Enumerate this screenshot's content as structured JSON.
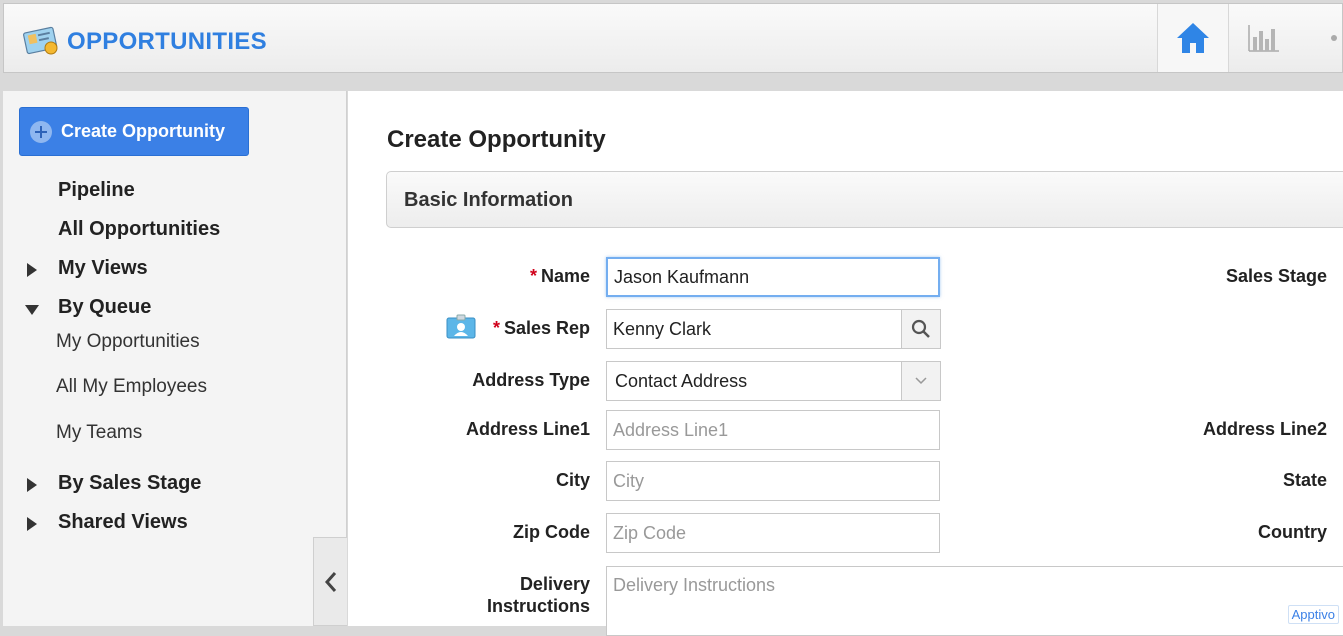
{
  "header": {
    "title": "OPPORTUNITIES",
    "icons": {
      "app": "opportunities-card-icon",
      "home": "home-icon",
      "reports": "bar-chart-icon"
    },
    "accent": "#2f7fe0"
  },
  "sidebar": {
    "create_button": "Create Opportunity",
    "items": [
      {
        "label": "Pipeline"
      },
      {
        "label": "All Opportunities"
      },
      {
        "label": "My Views"
      },
      {
        "label": "By Queue"
      },
      {
        "label": "My Opportunities"
      },
      {
        "label": "All My Employees"
      },
      {
        "label": "My Teams"
      },
      {
        "label": "By Sales Stage"
      },
      {
        "label": "Shared Views"
      }
    ]
  },
  "main": {
    "title": "Create Opportunity",
    "section": "Basic Information",
    "fields": {
      "name": {
        "label": "Name",
        "value": "Jason Kaufmann"
      },
      "sales_rep": {
        "label": "Sales Rep",
        "value": "Kenny Clark"
      },
      "address_type": {
        "label": "Address Type",
        "value": "Contact Address"
      },
      "address_line1": {
        "label": "Address Line1",
        "placeholder": "Address Line1"
      },
      "city": {
        "label": "City",
        "placeholder": "City"
      },
      "zip": {
        "label": "Zip Code",
        "placeholder": "Zip Code"
      },
      "delivery": {
        "label_line1": "Delivery",
        "label_line2": "Instructions",
        "placeholder": "Delivery Instructions"
      }
    },
    "right_labels": {
      "sales_stage": "Sales Stage",
      "address_line2": "Address Line2",
      "state": "State",
      "country": "Country"
    }
  },
  "watermark": "Apptivo"
}
